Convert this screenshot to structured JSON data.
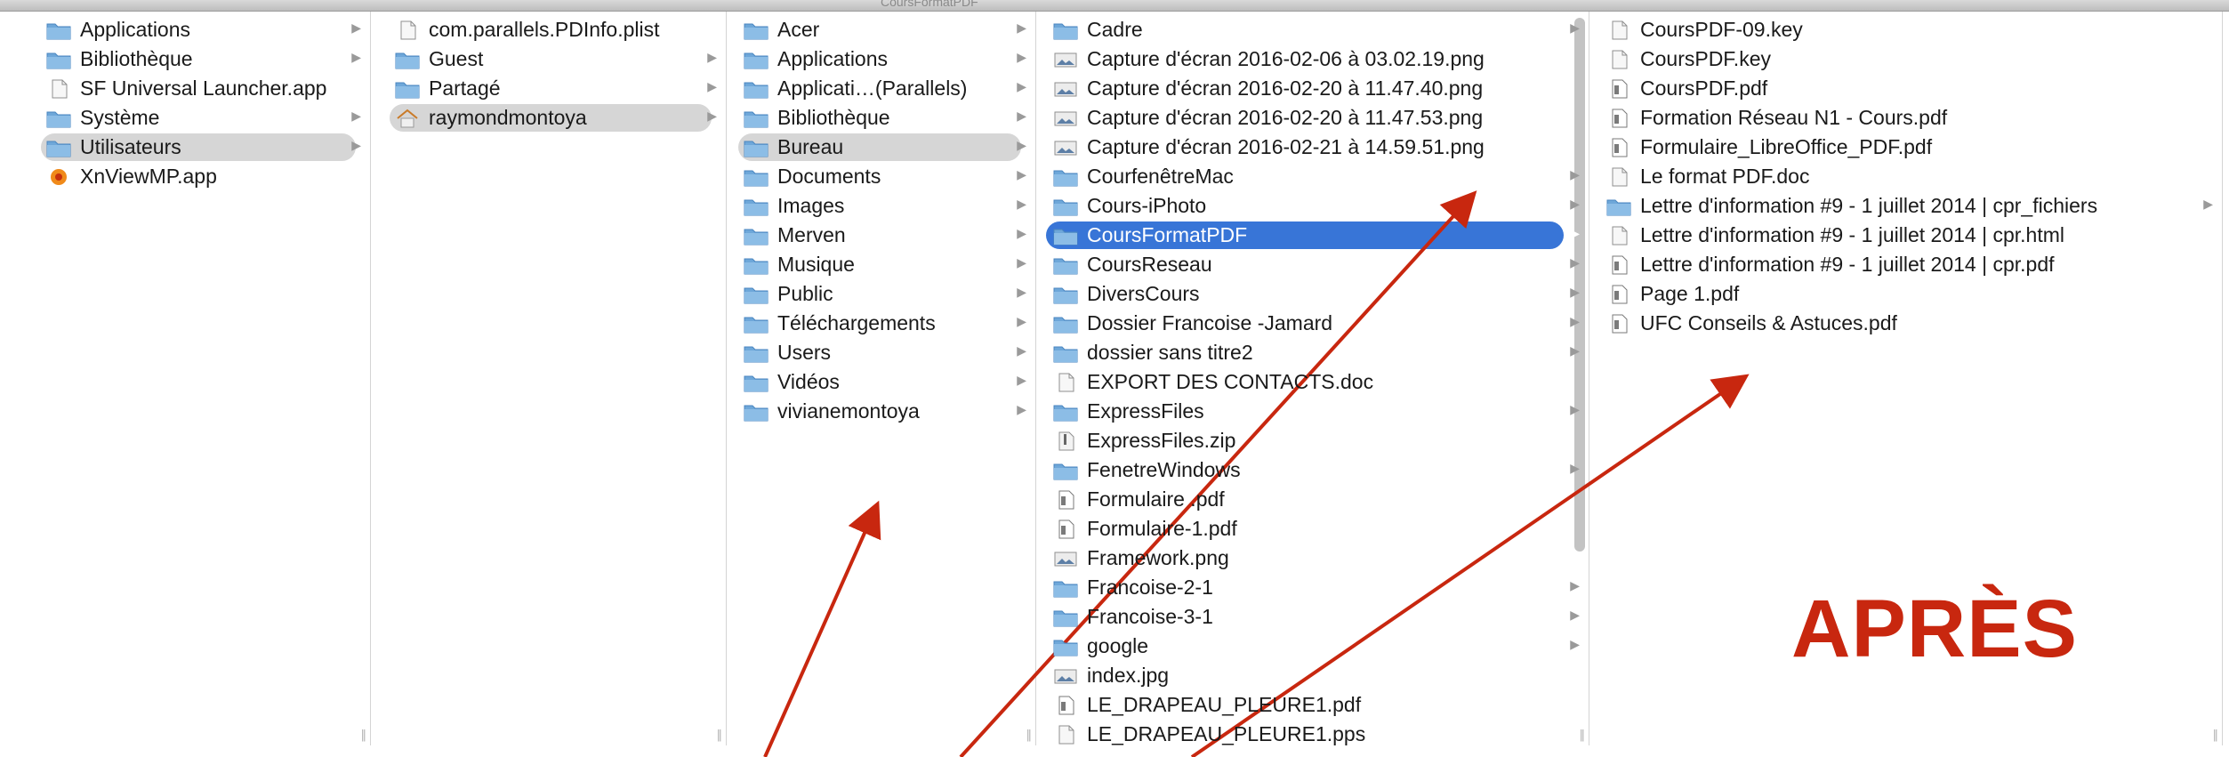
{
  "window": {
    "title": "CoursFormatPDF"
  },
  "columns": [
    {
      "id": "root",
      "items": [
        {
          "label": "Applications",
          "icon": "folder-icon",
          "chevron": true,
          "selected": ""
        },
        {
          "label": "Bibliothèque",
          "icon": "folder-icon",
          "chevron": true,
          "selected": ""
        },
        {
          "label": "SF Universal Launcher.app",
          "icon": "document-icon",
          "chevron": false,
          "selected": ""
        },
        {
          "label": "Système",
          "icon": "folder-icon",
          "chevron": true,
          "selected": ""
        },
        {
          "label": "Utilisateurs",
          "icon": "folder-icon",
          "chevron": true,
          "selected": "grey"
        },
        {
          "label": "XnViewMP.app",
          "icon": "app-icon",
          "chevron": false,
          "selected": ""
        }
      ]
    },
    {
      "id": "users",
      "items": [
        {
          "label": "com.parallels.PDInfo.plist",
          "icon": "document-icon",
          "chevron": false,
          "selected": ""
        },
        {
          "label": "Guest",
          "icon": "folder-icon",
          "chevron": true,
          "selected": ""
        },
        {
          "label": "Partagé",
          "icon": "folder-icon",
          "chevron": true,
          "selected": ""
        },
        {
          "label": "raymondmontoya",
          "icon": "home-icon",
          "chevron": true,
          "selected": "grey"
        }
      ]
    },
    {
      "id": "home",
      "items": [
        {
          "label": "Acer",
          "icon": "folder-icon",
          "chevron": true,
          "selected": ""
        },
        {
          "label": "Applications",
          "icon": "folder-icon",
          "chevron": true,
          "selected": ""
        },
        {
          "label": "Applicati…(Parallels)",
          "icon": "folder-icon",
          "chevron": true,
          "selected": ""
        },
        {
          "label": "Bibliothèque",
          "icon": "folder-icon",
          "chevron": true,
          "selected": ""
        },
        {
          "label": "Bureau",
          "icon": "folder-icon",
          "chevron": true,
          "selected": "grey"
        },
        {
          "label": "Documents",
          "icon": "folder-icon",
          "chevron": true,
          "selected": ""
        },
        {
          "label": "Images",
          "icon": "folder-icon",
          "chevron": true,
          "selected": ""
        },
        {
          "label": "Merven",
          "icon": "folder-icon",
          "chevron": true,
          "selected": ""
        },
        {
          "label": "Musique",
          "icon": "folder-icon",
          "chevron": true,
          "selected": ""
        },
        {
          "label": "Public",
          "icon": "folder-icon",
          "chevron": true,
          "selected": ""
        },
        {
          "label": "Téléchargements",
          "icon": "folder-icon",
          "chevron": true,
          "selected": ""
        },
        {
          "label": "Users",
          "icon": "folder-icon",
          "chevron": true,
          "selected": ""
        },
        {
          "label": "Vidéos",
          "icon": "folder-icon",
          "chevron": true,
          "selected": ""
        },
        {
          "label": "vivianemontoya",
          "icon": "folder-icon",
          "chevron": true,
          "selected": ""
        }
      ]
    },
    {
      "id": "bureau",
      "items": [
        {
          "label": "Cadre",
          "icon": "folder-icon",
          "chevron": true,
          "selected": ""
        },
        {
          "label": "Capture d'écran 2016-02-06 à 03.02.19.png",
          "icon": "image-icon",
          "chevron": false,
          "selected": ""
        },
        {
          "label": "Capture d'écran 2016-02-20 à 11.47.40.png",
          "icon": "image-icon",
          "chevron": false,
          "selected": ""
        },
        {
          "label": "Capture d'écran 2016-02-20 à 11.47.53.png",
          "icon": "image-icon",
          "chevron": false,
          "selected": ""
        },
        {
          "label": "Capture d'écran 2016-02-21 à 14.59.51.png",
          "icon": "image-icon",
          "chevron": false,
          "selected": ""
        },
        {
          "label": "CourfenêtreMac",
          "icon": "folder-icon",
          "chevron": true,
          "selected": ""
        },
        {
          "label": "Cours-iPhoto",
          "icon": "folder-icon",
          "chevron": true,
          "selected": ""
        },
        {
          "label": "CoursFormatPDF",
          "icon": "folder-icon",
          "chevron": true,
          "selected": "blue"
        },
        {
          "label": "CoursReseau",
          "icon": "folder-icon",
          "chevron": true,
          "selected": ""
        },
        {
          "label": "DiversCours",
          "icon": "folder-icon",
          "chevron": true,
          "selected": ""
        },
        {
          "label": "Dossier Francoise -Jamard",
          "icon": "folder-icon",
          "chevron": true,
          "selected": ""
        },
        {
          "label": "dossier sans titre2",
          "icon": "folder-icon",
          "chevron": true,
          "selected": ""
        },
        {
          "label": "EXPORT DES CONTACTS.doc",
          "icon": "document-icon",
          "chevron": false,
          "selected": ""
        },
        {
          "label": "ExpressFiles",
          "icon": "folder-icon",
          "chevron": true,
          "selected": ""
        },
        {
          "label": "ExpressFiles.zip",
          "icon": "zip-icon",
          "chevron": false,
          "selected": ""
        },
        {
          "label": "FenetreWindows",
          "icon": "folder-icon",
          "chevron": true,
          "selected": ""
        },
        {
          "label": "Formulaire .pdf",
          "icon": "pdf-icon",
          "chevron": false,
          "selected": ""
        },
        {
          "label": "Formulaire-1.pdf",
          "icon": "pdf-icon",
          "chevron": false,
          "selected": ""
        },
        {
          "label": "Framework.png",
          "icon": "image-icon",
          "chevron": false,
          "selected": ""
        },
        {
          "label": "Francoise-2-1",
          "icon": "folder-icon",
          "chevron": true,
          "selected": ""
        },
        {
          "label": "Francoise-3-1",
          "icon": "folder-icon",
          "chevron": true,
          "selected": ""
        },
        {
          "label": "google",
          "icon": "folder-icon",
          "chevron": true,
          "selected": ""
        },
        {
          "label": "index.jpg",
          "icon": "image-icon",
          "chevron": false,
          "selected": ""
        },
        {
          "label": "LE_DRAPEAU_PLEURE1.pdf",
          "icon": "pdf-icon",
          "chevron": false,
          "selected": ""
        },
        {
          "label": "LE_DRAPEAU_PLEURE1.pps",
          "icon": "document-icon",
          "chevron": false,
          "selected": ""
        }
      ]
    },
    {
      "id": "coursformatpdf",
      "items": [
        {
          "label": "CoursPDF-09.key",
          "icon": "document-icon",
          "chevron": false,
          "selected": ""
        },
        {
          "label": "CoursPDF.key",
          "icon": "document-icon",
          "chevron": false,
          "selected": ""
        },
        {
          "label": "CoursPDF.pdf",
          "icon": "pdf-icon",
          "chevron": false,
          "selected": ""
        },
        {
          "label": "Formation Réseau N1 - Cours.pdf",
          "icon": "pdf-icon",
          "chevron": false,
          "selected": ""
        },
        {
          "label": "Formulaire_LibreOffice_PDF.pdf",
          "icon": "pdf-icon",
          "chevron": false,
          "selected": ""
        },
        {
          "label": "Le format PDF.doc",
          "icon": "document-icon",
          "chevron": false,
          "selected": ""
        },
        {
          "label": "Lettre d'information #9 - 1 juillet 2014 | cpr_fichiers",
          "icon": "folder-icon",
          "chevron": true,
          "selected": ""
        },
        {
          "label": "Lettre d'information #9 - 1 juillet 2014 | cpr.html",
          "icon": "document-icon",
          "chevron": false,
          "selected": ""
        },
        {
          "label": "Lettre d'information #9 - 1 juillet 2014 | cpr.pdf",
          "icon": "pdf-icon",
          "chevron": false,
          "selected": ""
        },
        {
          "label": "Page 1.pdf",
          "icon": "pdf-icon",
          "chevron": false,
          "selected": ""
        },
        {
          "label": "UFC Conseils & Astuces.pdf",
          "icon": "pdf-icon",
          "chevron": false,
          "selected": ""
        }
      ]
    }
  ],
  "annotation": {
    "text": "APRÈS",
    "color": "#c8270f"
  },
  "colors": {
    "selection_blue": "#3875d7",
    "selection_grey": "#d6d6d6",
    "folder_blue": "#6ea7d9"
  }
}
